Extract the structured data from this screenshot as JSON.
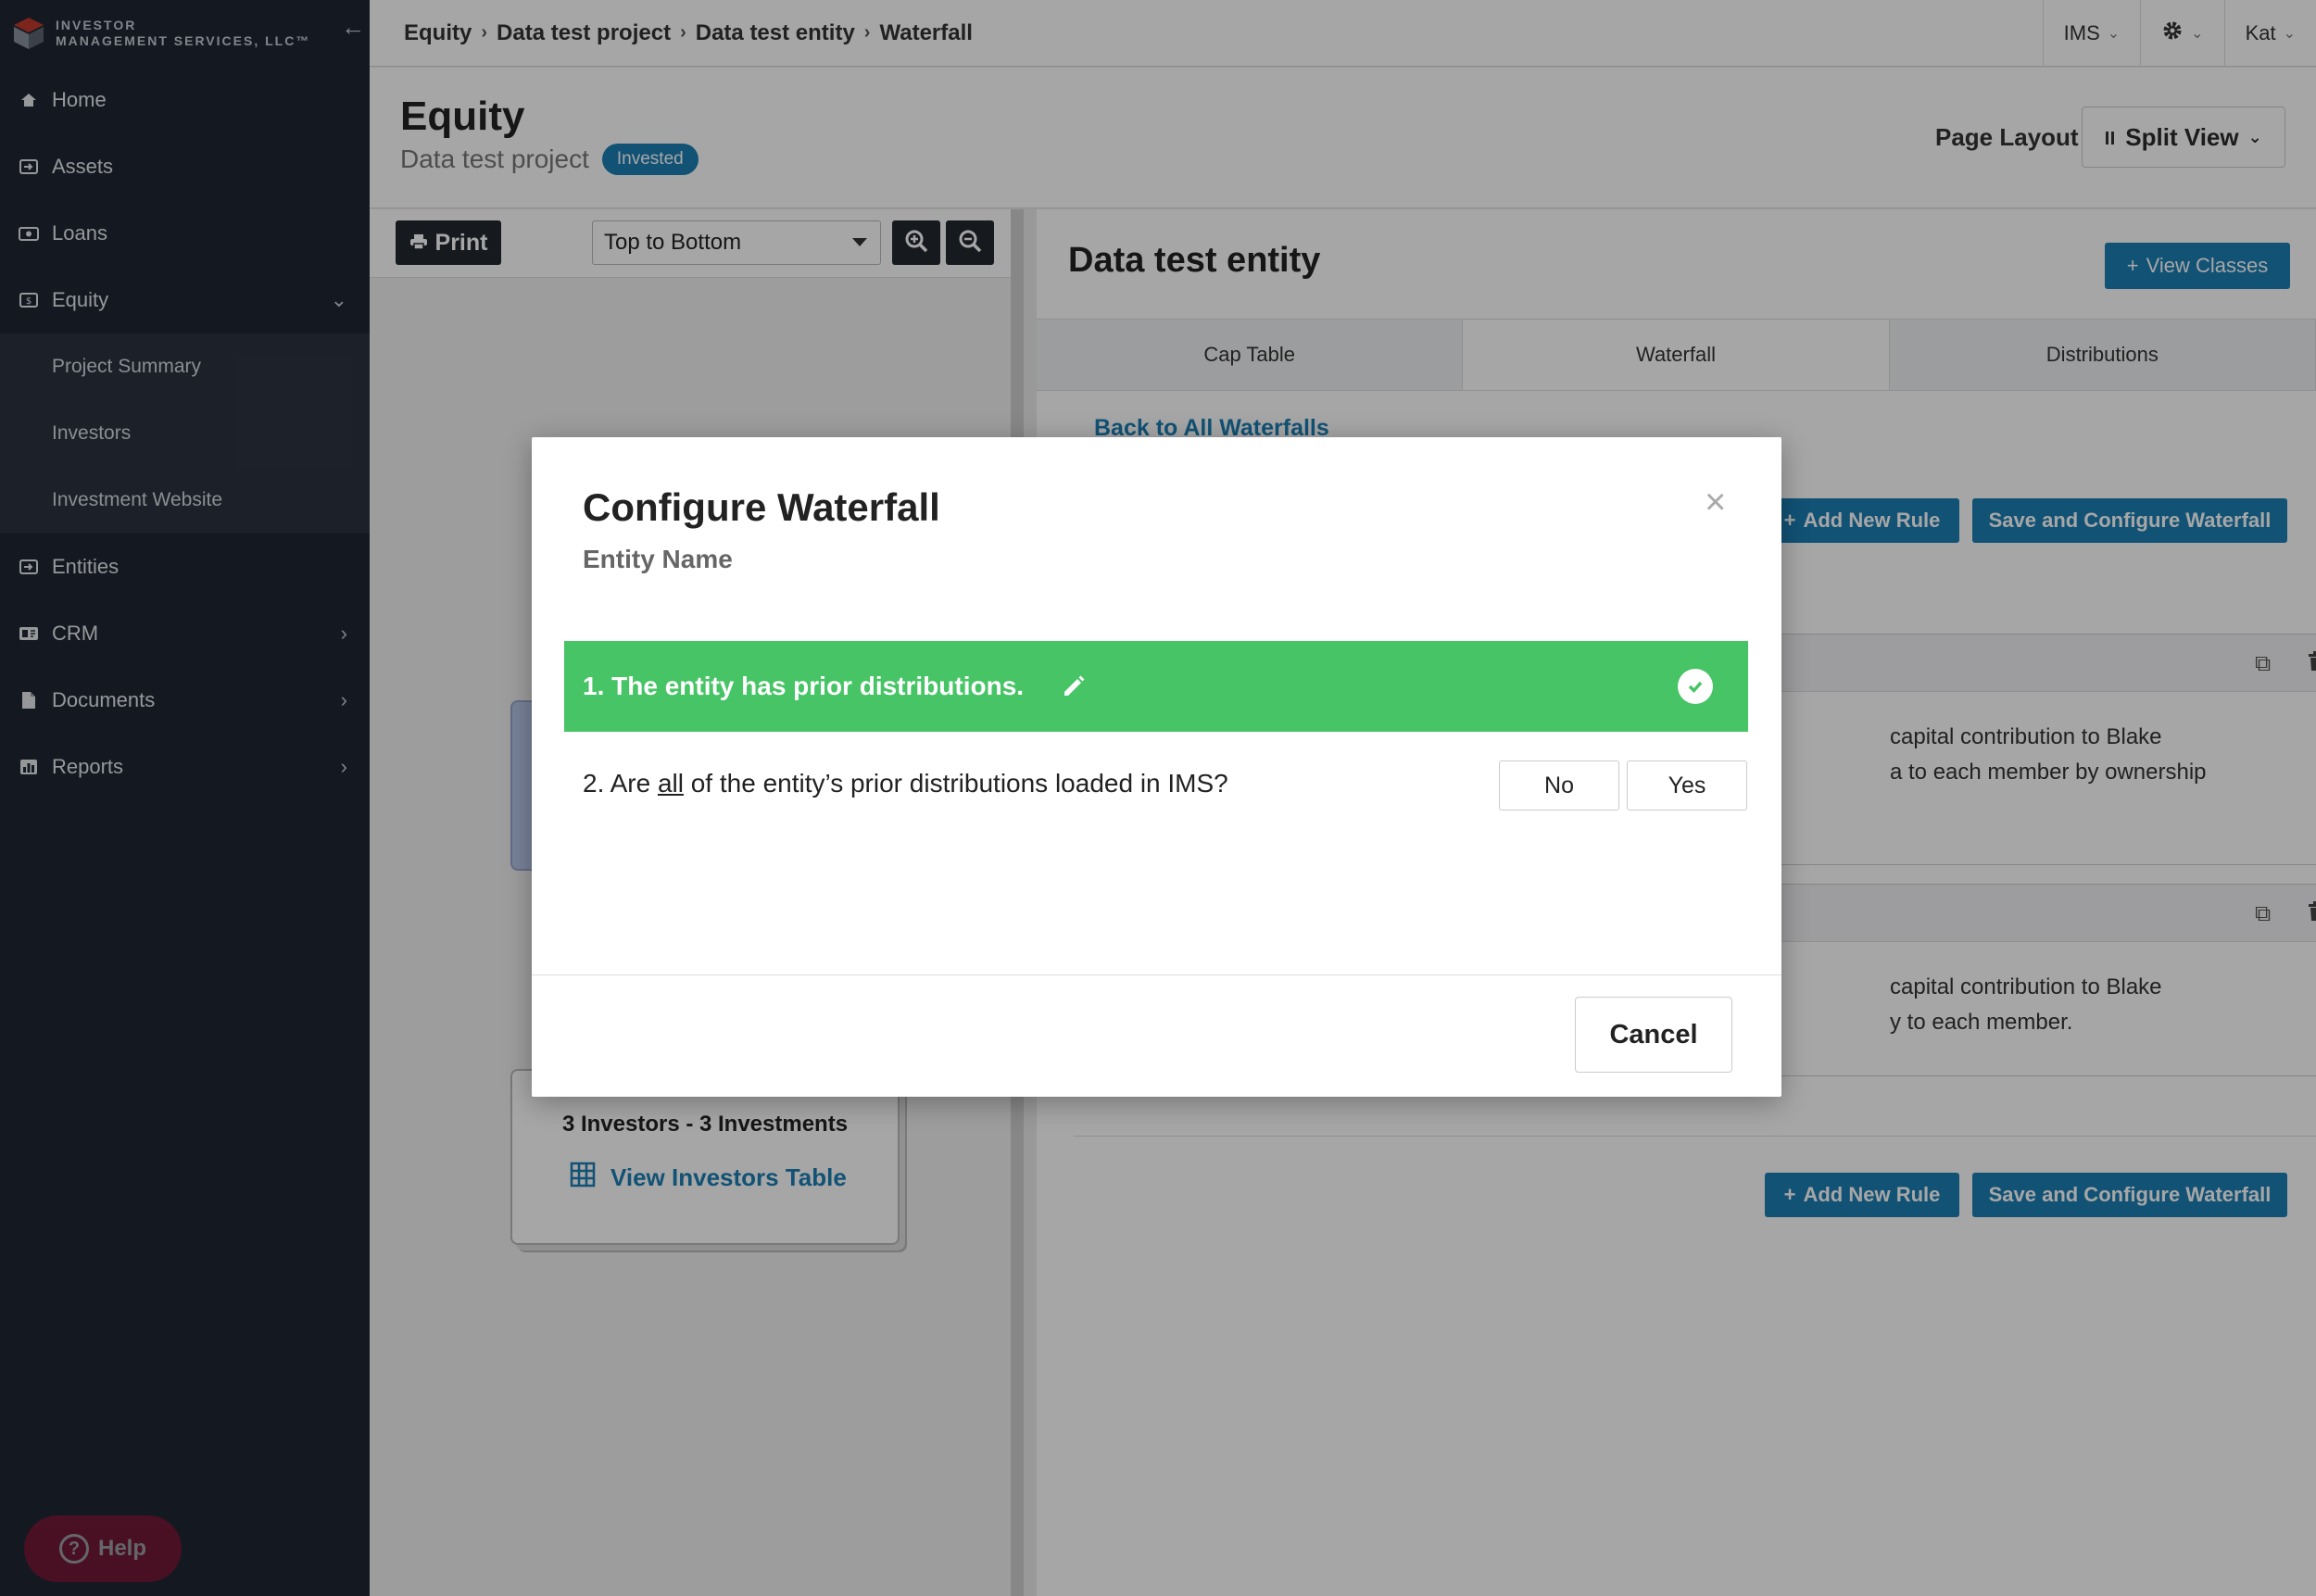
{
  "brand": {
    "line1": "INVESTOR",
    "line2": "MANAGEMENT SERVICES, LLC™"
  },
  "sidebar": {
    "items": [
      {
        "label": "Home"
      },
      {
        "label": "Assets"
      },
      {
        "label": "Loans"
      },
      {
        "label": "Equity"
      },
      {
        "label": "Entities"
      },
      {
        "label": "CRM"
      },
      {
        "label": "Documents"
      },
      {
        "label": "Reports"
      }
    ],
    "equity_sub": [
      "Project Summary",
      "Investors",
      "Investment Website"
    ],
    "help_label": "Help"
  },
  "breadcrumb": [
    "Equity",
    "Data test project",
    "Data test entity",
    "Waterfall"
  ],
  "topbar": {
    "org": "IMS",
    "user": "Kat"
  },
  "page": {
    "title": "Equity",
    "subtitle": "Data test project",
    "status_badge": "Invested",
    "layout_label": "Page Layout",
    "layout_value": "Split View"
  },
  "left_pane": {
    "print_label": "Print",
    "direction_select": "Top to Bottom",
    "investors_summary": "3 Investors - 3 Investments",
    "view_investors_link": "View Investors Table"
  },
  "right_pane": {
    "entity_title": "Data test entity",
    "view_classes_label": "View Classes",
    "tabs": [
      "Cap Table",
      "Waterfall",
      "Distributions"
    ],
    "back_link": "Back to All Waterfalls",
    "add_rule_label": "Add New Rule",
    "save_configure_label": "Save and Configure Waterfall",
    "rules": [
      {
        "line1": "capital contribution to Blake",
        "line2": "a to each member by ownership"
      },
      {
        "line1": "capital contribution to Blake",
        "line2": "y to each member."
      }
    ]
  },
  "modal": {
    "title": "Configure Waterfall",
    "subtitle": "Entity Name",
    "step1": "1. The entity has prior distributions.",
    "step2_pre": "2. Are ",
    "step2_em": "all",
    "step2_post": " of the entity’s prior distributions loaded in IMS?",
    "no_label": "No",
    "yes_label": "Yes",
    "cancel_label": "Cancel"
  },
  "colors": {
    "sidebar_bg": "#1f2633",
    "accent": "#1b7fb4",
    "success": "#47c466",
    "help": "#b3123a"
  }
}
